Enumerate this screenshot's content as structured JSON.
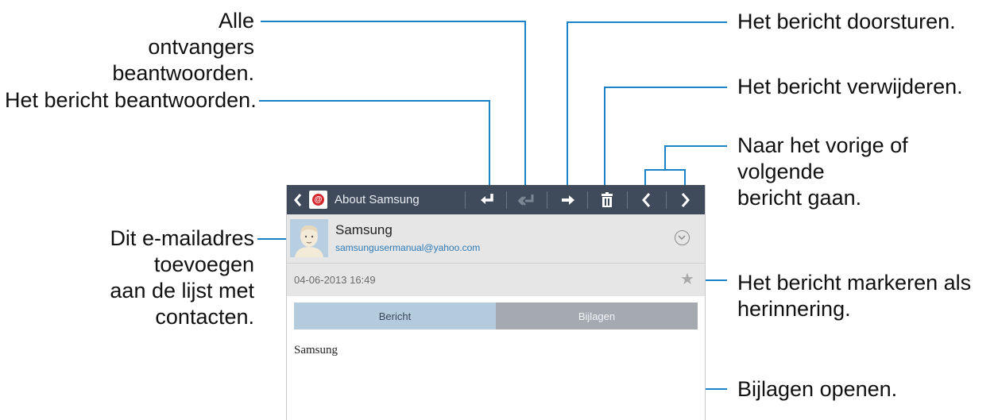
{
  "callouts": {
    "reply_all": "Alle ontvangers\nbeantwoorden.",
    "reply": "Het bericht beantwoorden.",
    "add_contact": "Dit e-mailadres toevoegen\naan de lijst met contacten.",
    "forward": "Het bericht doorsturen.",
    "delete": "Het bericht verwijderen.",
    "prev_next": "Naar het vorige of volgende\nbericht gaan.",
    "mark": "Het bericht markeren als\nherinnering.",
    "open_attachments": "Bijlagen openen."
  },
  "screen": {
    "actionbar": {
      "title": "About Samsung",
      "app_icon": "email-app-icon",
      "buttons": [
        "reply-icon",
        "reply-all-icon",
        "forward-icon",
        "delete-icon",
        "previous-icon",
        "next-icon"
      ]
    },
    "sender": {
      "name": "Samsung",
      "email": "samsungusermanual@yahoo.com"
    },
    "date": "04-06-2013  16:49",
    "tabs": {
      "message": "Bericht",
      "attachments": "Bijlagen"
    },
    "body": "Samsung"
  },
  "colors": {
    "actionbar": "#3f4b5b",
    "tab_message": "#b4cadd",
    "tab_attachments": "#a5aab1",
    "email_link": "#2e7bb8",
    "callout_line": "#1a82c6"
  }
}
